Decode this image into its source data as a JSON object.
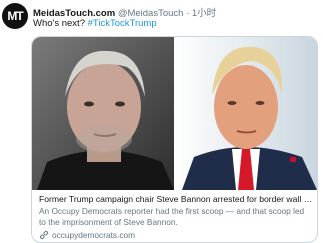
{
  "tweet": {
    "avatar_text": "MT",
    "display_name": "MeidasTouch.com",
    "handle": "@MeidasTouch",
    "separator": "·",
    "time": "1小时",
    "text_prefix": "Who's next? ",
    "hashtag": "#TickTockTrump"
  },
  "card": {
    "title": "Former Trump campaign chair Steve Bannon arrested for border wall f...",
    "description": "An Occupy Democrats reporter had the first scoop — and that scoop led to the imprisonment of Steve Bannon.",
    "domain": "occupydemocrats.com",
    "domain_icon": "link-icon"
  }
}
